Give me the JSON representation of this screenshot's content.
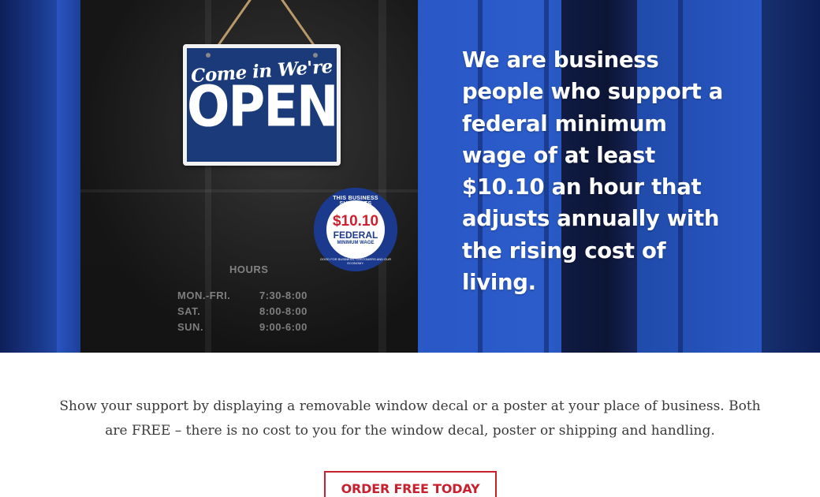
{
  "hero": {
    "headline": "We are business people who support a federal minimum wage of at least $10.10 an hour that adjusts annually with the rising cost of living.",
    "sign": {
      "line1": "Come in We're",
      "line2": "OPEN"
    },
    "badge": {
      "ring_text": "THIS BUSINESS SUPPORTS",
      "price": "$10.10",
      "federal": "FEDERAL",
      "minimum_wage": "MINIMUM WAGE",
      "bottom_text": "GOOD FOR BUSINESS, CUSTOMERS AND OUR ECONOMY."
    },
    "hours": {
      "title": "HOURS",
      "rows": [
        {
          "day": "MON.-FRI.",
          "time": "7:30-8:00"
        },
        {
          "day": "SAT.",
          "time": "8:00-8:00"
        },
        {
          "day": "SUN.",
          "time": "9:00-6:00"
        }
      ]
    }
  },
  "intro": {
    "text": "Show your support by displaying a removable window decal or a poster at your place of business. Both are FREE – there is no cost to you for the window decal, poster or shipping and handling."
  },
  "cta": {
    "label": "ORDER FREE TODAY"
  },
  "colors": {
    "navy": "#13265f",
    "door_blue": "#2b5cc9",
    "cta_red": "#c8202f",
    "text_gray": "#3a3a3a"
  }
}
